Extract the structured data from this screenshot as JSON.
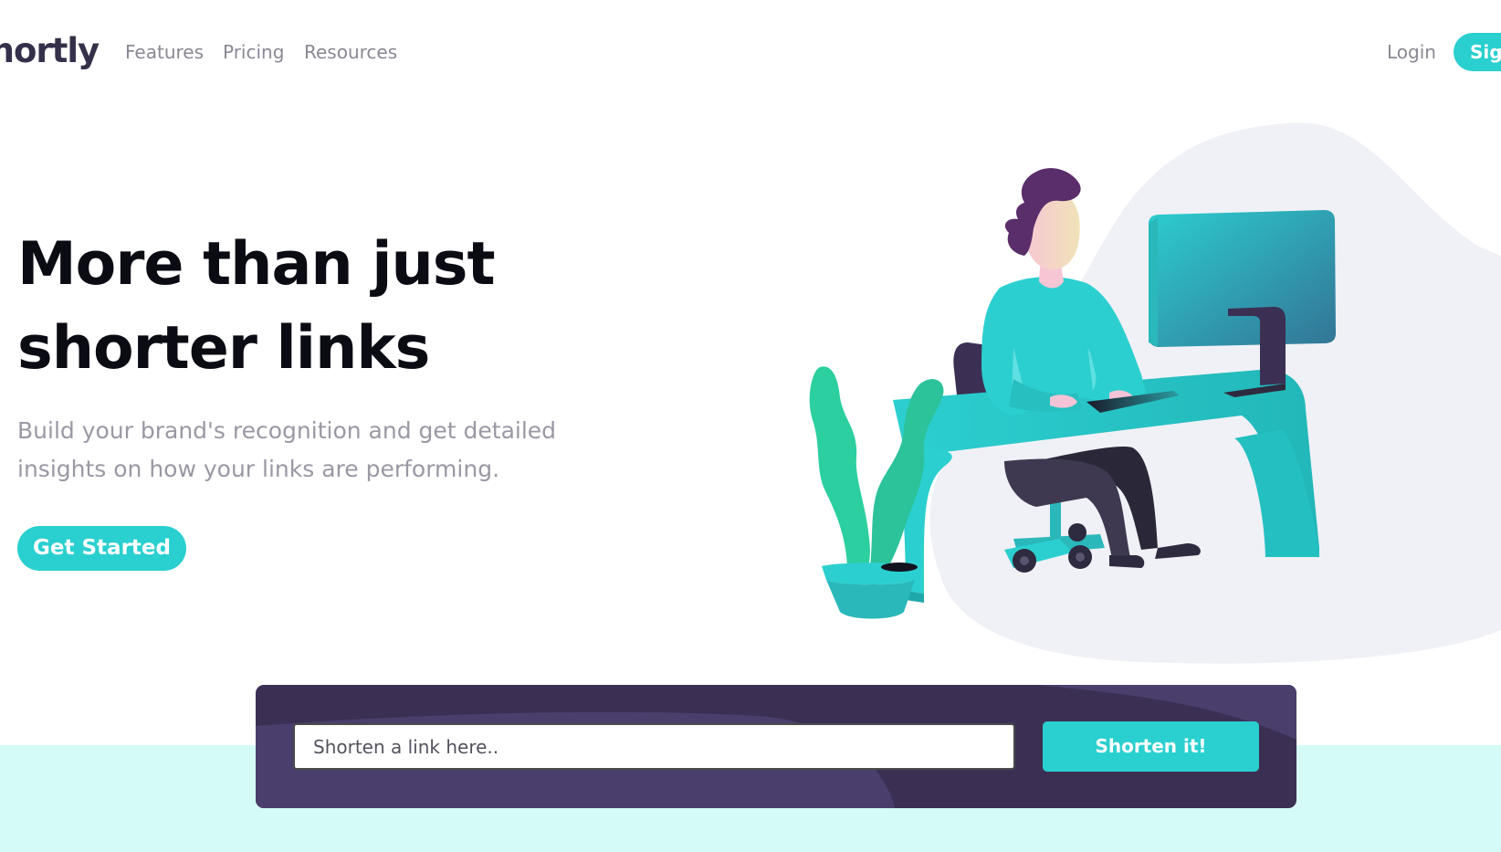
{
  "header": {
    "logo_text": "Shortly",
    "nav": [
      {
        "label": "Features"
      },
      {
        "label": "Pricing"
      },
      {
        "label": "Resources"
      }
    ],
    "login_label": "Login",
    "signup_label": "Sign Up"
  },
  "hero": {
    "title_line1": "More than just",
    "title_line2": "shorter links",
    "description": "Build your brand's recognition and get detailed insights on how your links are performing.",
    "cta_label": "Get Started"
  },
  "shorten": {
    "placeholder": "Shorten a link here..",
    "value": "",
    "button_label": "Shorten it!"
  },
  "colors": {
    "primary": "#2acfcf",
    "dark_violet": "#3b3054",
    "grayish_violet": "#9a98a4",
    "very_dark_blue": "#35304a",
    "band": "#d5fbf6"
  }
}
